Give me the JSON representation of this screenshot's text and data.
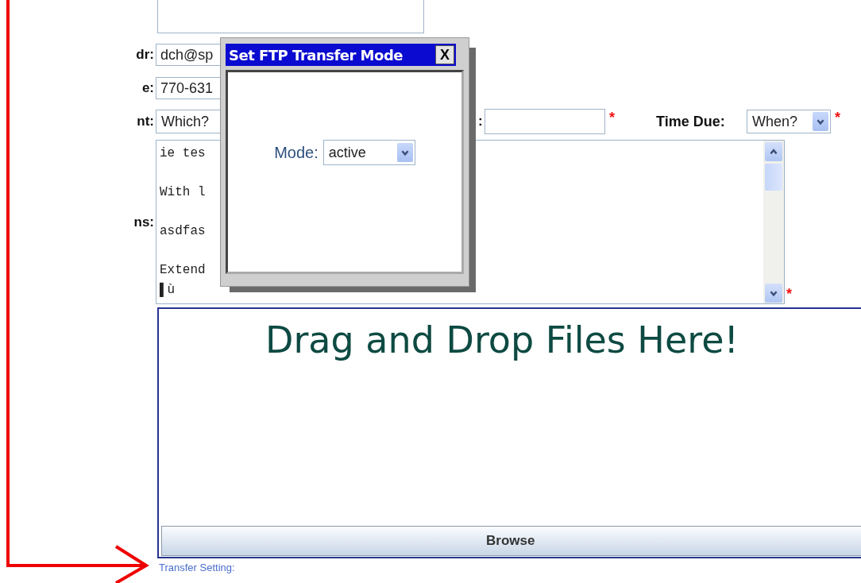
{
  "form": {
    "rows": [
      {
        "label": "dr:",
        "value": "dch@sp"
      },
      {
        "label": "e:",
        "value": "770-631"
      }
    ],
    "select_row": {
      "label": "nt:",
      "select_value": "Which?",
      "hidden_label": ":",
      "date_required_mark": "*",
      "time_label": "Time Due:",
      "time_value": "When?",
      "time_required_mark": "*"
    },
    "notes": {
      "label": "ns:",
      "text": "ie tes\n\nWith l\n\nasdfas\n\nExtend\n▌ù",
      "required_mark": "*"
    }
  },
  "drop_zone": {
    "heading": "Drag and Drop Files Here!",
    "button": "Browse"
  },
  "transfer_link": "Transfer Setting:",
  "dialog": {
    "title": "Set FTP Transfer Mode",
    "close": "X",
    "mode_label": "Mode:",
    "mode_value": "active"
  }
}
